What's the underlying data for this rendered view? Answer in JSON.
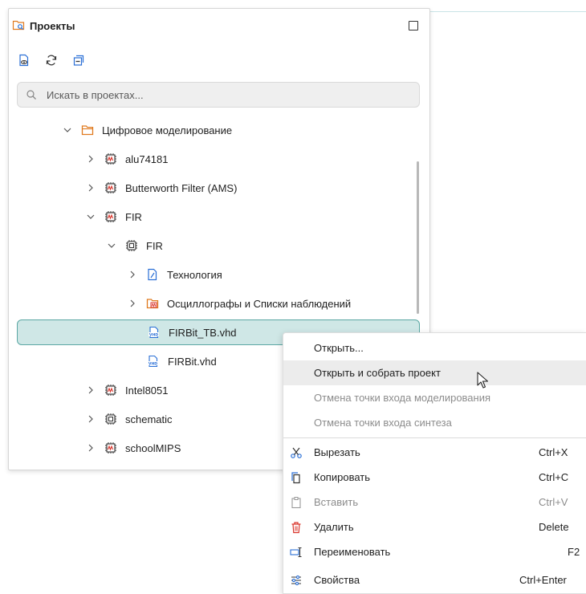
{
  "panel": {
    "title": "Проекты",
    "search_placeholder": "Искать в проектах..."
  },
  "toolbar": {
    "icons": [
      "show-project-icon",
      "refresh-icon",
      "collapse-all-icon"
    ]
  },
  "tree": [
    {
      "label": "Цифровое моделирование",
      "expanded": true,
      "icon": "folder-icon"
    },
    {
      "label": "alu74181",
      "expanded": false,
      "icon": "waveform-chip-icon"
    },
    {
      "label": "Butterworth Filter  (AMS)",
      "expanded": false,
      "icon": "waveform-chip-icon"
    },
    {
      "label": "FIR",
      "expanded": true,
      "icon": "waveform-chip-icon"
    },
    {
      "label": "FIR",
      "expanded": true,
      "icon": "chip-icon"
    },
    {
      "label": "Технология",
      "expanded": false,
      "icon": "document-icon"
    },
    {
      "label": "Осциллографы и Списки наблюдений",
      "expanded": false,
      "icon": "scope-folder-icon"
    },
    {
      "label": "FIRBit_TB.vhd",
      "selected": true,
      "icon": "vhd-file-icon"
    },
    {
      "label": "FIRBit.vhd",
      "icon": "vhd-file-icon"
    },
    {
      "label": "Intel8051",
      "expanded": false,
      "icon": "waveform-chip-icon"
    },
    {
      "label": "schematic",
      "expanded": false,
      "icon": "chip-icon"
    },
    {
      "label": "schoolMIPS",
      "expanded": false,
      "icon": "waveform-chip-icon"
    }
  ],
  "menu": {
    "items": [
      {
        "label": "Открыть...",
        "shortcut": "",
        "disabled": false
      },
      {
        "label": "Открыть и собрать проект",
        "shortcut": "",
        "disabled": false,
        "hover": true
      },
      {
        "label": "Отмена точки входа моделирования",
        "shortcut": "",
        "disabled": true
      },
      {
        "label": "Отмена точки входа синтеза",
        "shortcut": "",
        "disabled": true
      },
      {
        "label": "Вырезать",
        "shortcut": "Ctrl+X",
        "disabled": false,
        "icon": "scissors-icon"
      },
      {
        "label": "Копировать",
        "shortcut": "Ctrl+C",
        "disabled": false,
        "icon": "copy-icon"
      },
      {
        "label": "Вставить",
        "shortcut": "Ctrl+V",
        "disabled": true,
        "icon": "paste-icon"
      },
      {
        "label": "Удалить",
        "shortcut": "Delete",
        "disabled": false,
        "icon": "trash-icon"
      },
      {
        "label": "Переименовать",
        "shortcut": "F2",
        "disabled": false,
        "icon": "rename-icon"
      },
      {
        "label": "Свойства",
        "shortcut": "Ctrl+Enter",
        "disabled": false,
        "icon": "properties-icon"
      }
    ]
  },
  "colors": {
    "selection_bg": "#cfe7e6",
    "selection_border": "#5aa7a3",
    "accent_orange": "#e07a1f",
    "accent_red": "#d9342b",
    "accent_blue": "#2a6fd6"
  }
}
